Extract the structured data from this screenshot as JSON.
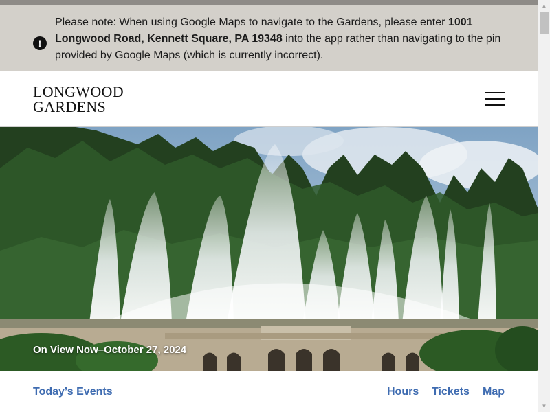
{
  "notice": {
    "icon": "exclamation-icon",
    "text_before": "Please note: When using Google Maps to navigate to the Gardens, please enter ",
    "address": "1001 Longwood Road, Kennett Square, PA 19348",
    "text_after": " into the app rather than navigating to the pin provided by Google Maps (which is currently incorrect)."
  },
  "header": {
    "logo_line1": "LONGWOOD",
    "logo_line2": "GARDENS",
    "menu_icon": "hamburger-menu-icon"
  },
  "hero": {
    "caption": "On View Now–October 27, 2024"
  },
  "links": {
    "todays_events": "Today’s Events",
    "hours": "Hours",
    "tickets": "Tickets",
    "map": "Map"
  },
  "colors": {
    "notice_bg": "#d3d0ca",
    "link": "#3f6cb1"
  }
}
